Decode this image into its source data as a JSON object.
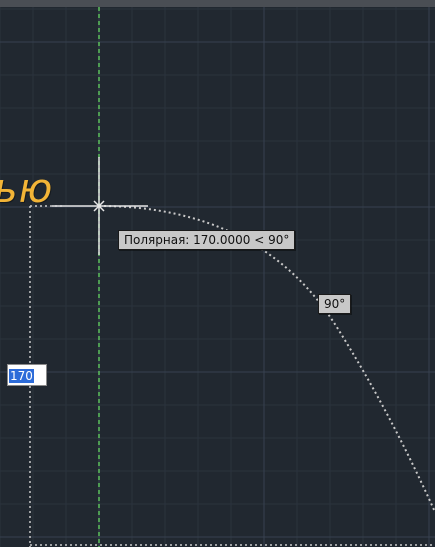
{
  "overlay": {
    "caption": "ью"
  },
  "tooltips": {
    "polar": "Полярная: 170.0000 < 90°",
    "angle": "90°"
  },
  "dimension_input": {
    "value": "170"
  },
  "colors": {
    "background": "#212830",
    "grid_minor": "#2b333d",
    "grid_major": "#374150",
    "polar_tracking": "#5ec25e",
    "arc_dotted": "#c9c9c9",
    "crosshair": "#e6e6e6",
    "caption": "#f2b437",
    "selection": "#2d6cd9"
  },
  "icons": {
    "cursor": "crosshair-cursor-icon"
  }
}
